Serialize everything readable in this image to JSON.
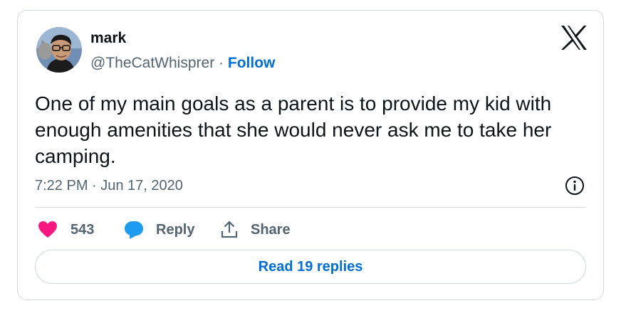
{
  "author": {
    "name": "mark",
    "handle": "@TheCatWhisprer",
    "separator": " · ",
    "follow_label": "Follow"
  },
  "tweet": {
    "text": "One of my main goals as a parent is to provide my kid with enough amenities that she would never ask me to take her camping.",
    "timestamp": "7:22 PM · Jun 17, 2020"
  },
  "actions": {
    "like_count": "543",
    "reply_label": "Reply",
    "share_label": "Share",
    "read_replies_label": "Read 19 replies"
  },
  "icons": {
    "logo": "x-logo-icon",
    "info": "info-icon",
    "like": "heart-icon",
    "reply": "speech-bubble-icon",
    "share": "share-icon"
  },
  "colors": {
    "like": "#f91880",
    "reply": "#1d9bf0",
    "link": "#006fd6",
    "secondary_text": "#536471"
  }
}
